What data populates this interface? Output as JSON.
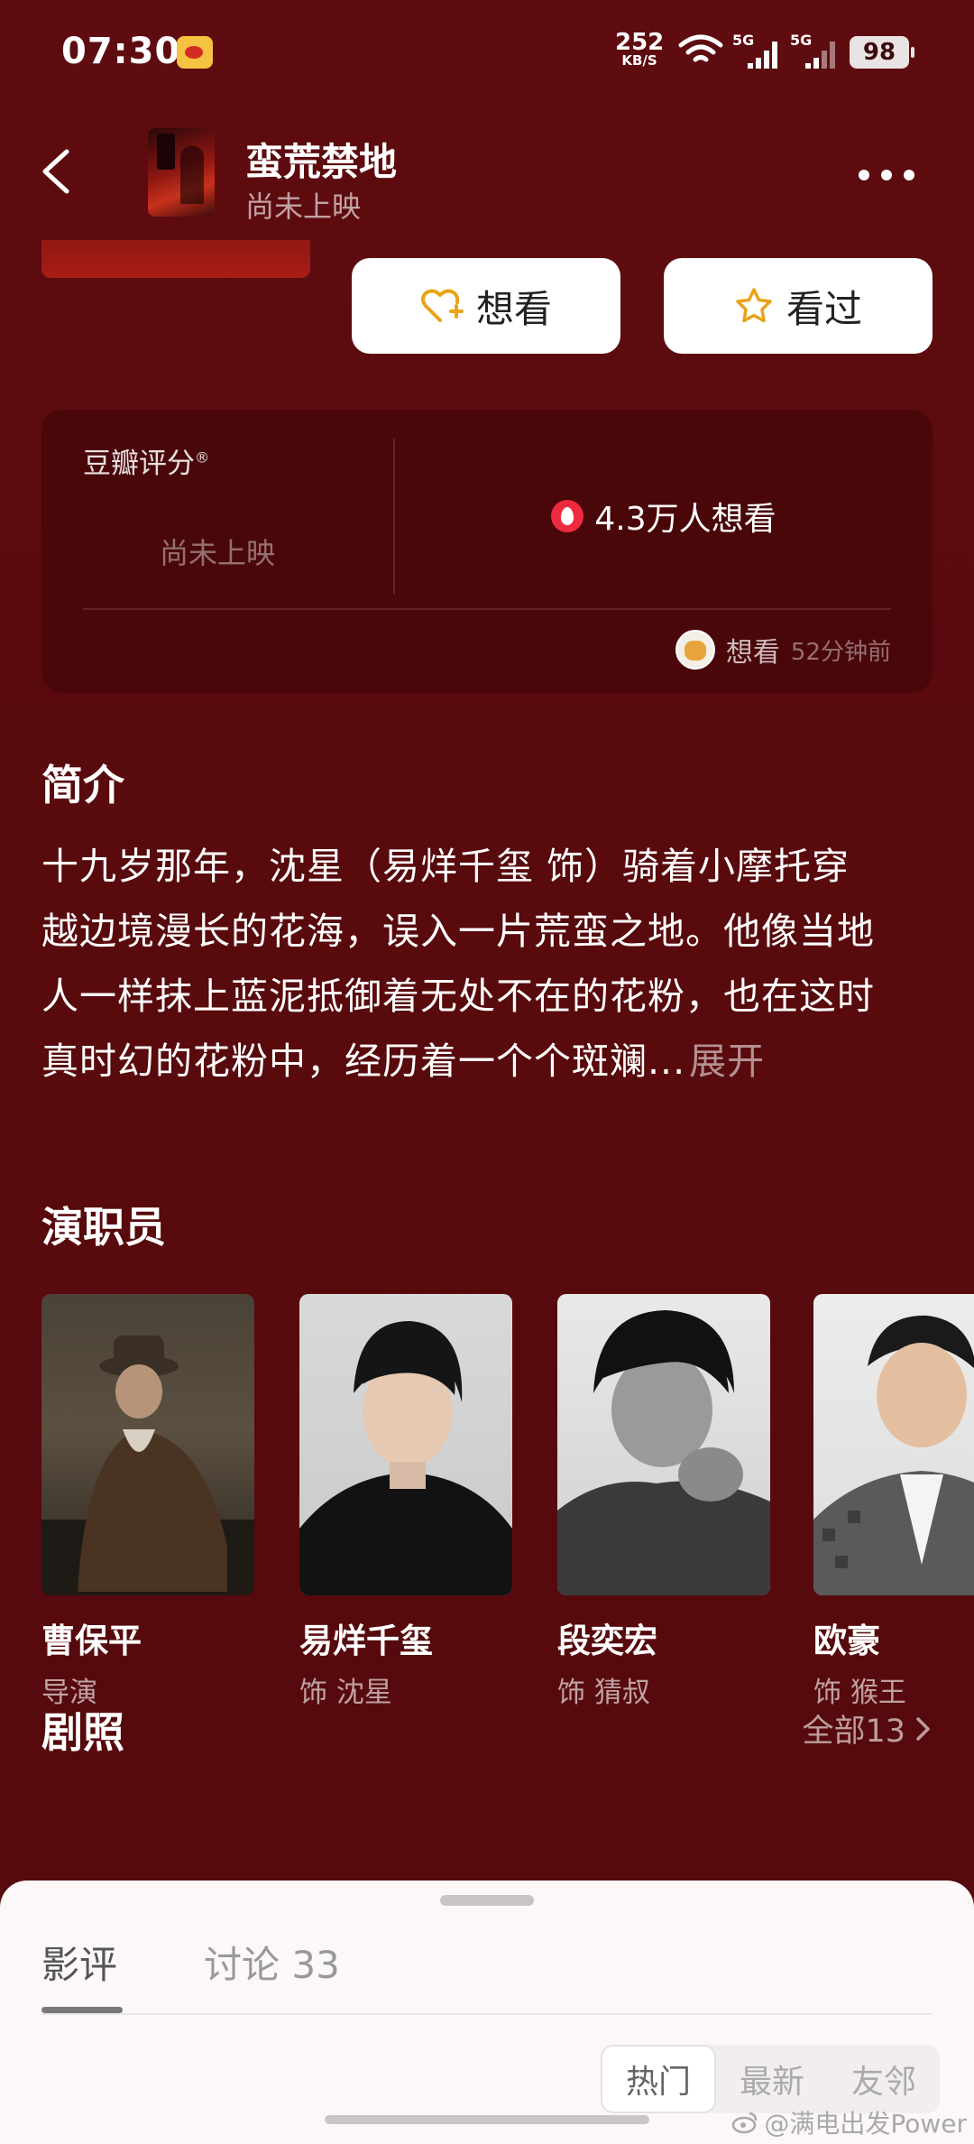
{
  "status_bar": {
    "time": "07:30",
    "net_speed_value": "252",
    "net_speed_unit": "KB/S",
    "signal1_label": "5G",
    "signal2_label": "5G",
    "battery": "98"
  },
  "header": {
    "title": "蛮荒禁地",
    "subtitle": "尚未上映"
  },
  "actions": {
    "want_label": "想看",
    "seen_label": "看过"
  },
  "rating": {
    "label": "豆瓣评分",
    "label_mark": "®",
    "status": "尚未上映",
    "want_count": "4.3万人想看",
    "activity_action": "想看",
    "activity_time": "52分钟前"
  },
  "synopsis": {
    "title": "简介",
    "lines": [
      "十九岁那年，沈星（易烊千玺 饰）骑着小摩托穿",
      "越边境漫长的花海，误入一片荒蛮之地。他像当地",
      "人一样抹上蓝泥抵御着无处不在的花粉，也在这时",
      "真时幻的花粉中，经历着一个个斑斓..."
    ],
    "expand_label": "展开"
  },
  "cast": {
    "title": "演职员",
    "members": [
      {
        "name": "曹保平",
        "role": "导演"
      },
      {
        "name": "易烊千玺",
        "role": "饰 沈星"
      },
      {
        "name": "段奕宏",
        "role": "饰 猜叔"
      },
      {
        "name": "欧豪",
        "role": "饰 猴王"
      }
    ]
  },
  "stills": {
    "title": "剧照",
    "all_label": "全部13"
  },
  "sheet": {
    "tab_reviews": "影评",
    "tab_discussion": "讨论 33",
    "sort_hot": "热门",
    "sort_latest": "最新",
    "sort_friends": "友邻"
  },
  "watermark": "@满电出发Power",
  "colors": {
    "background": "#5b0b0e",
    "card": "#4a070a",
    "accent_fire": "#ee2b3e",
    "icon_gold": "#e8a317"
  }
}
